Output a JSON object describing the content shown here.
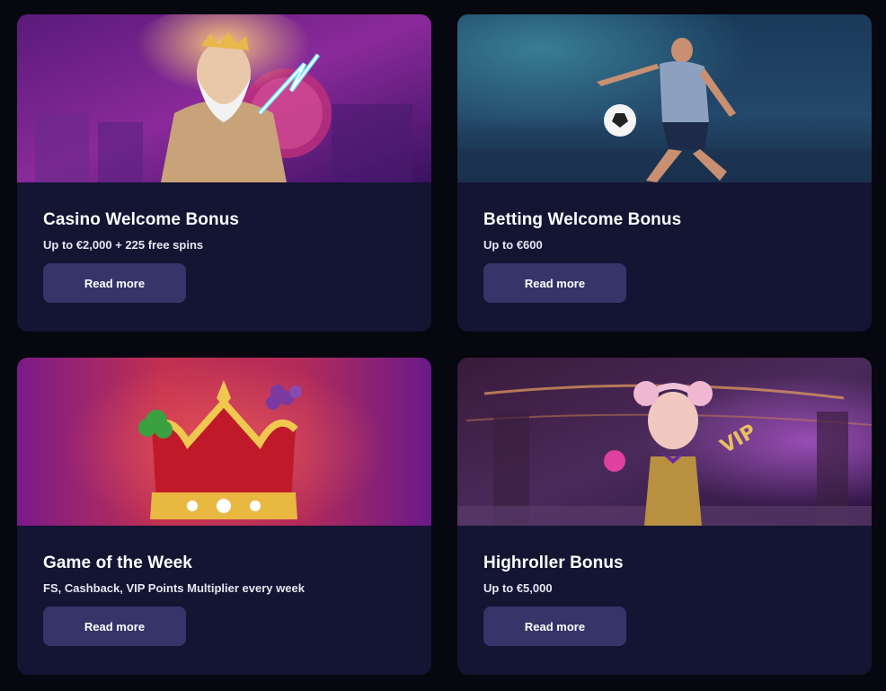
{
  "cards": [
    {
      "title": "Casino Welcome Bonus",
      "subtitle": "Up to €2,000 + 225 free spins",
      "button_label": "Read more",
      "image": "zeus-lightning-casino-banner"
    },
    {
      "title": "Betting Welcome Bonus",
      "subtitle": "Up to €600",
      "button_label": "Read more",
      "image": "football-player-kicking-ball-banner"
    },
    {
      "title": "Game of the Week",
      "subtitle": "FS, Cashback, VIP Points Multiplier every week",
      "button_label": "Read more",
      "image": "golden-crown-slot-banner"
    },
    {
      "title": "Highroller Bonus",
      "subtitle": "Up to €5,000",
      "button_label": "Read more",
      "image": "vip-jester-girl-banner"
    }
  ],
  "colors": {
    "page_background": "#07070f",
    "card_background": "#141433",
    "button_background": "#35356a",
    "text_primary": "#ffffff"
  }
}
